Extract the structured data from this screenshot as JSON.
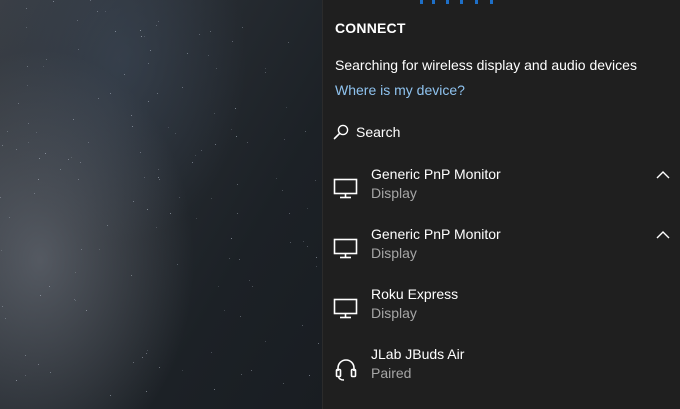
{
  "panel": {
    "title": "CONNECT",
    "status": "Searching for wireless display and audio devices",
    "help_link": "Where is my device?",
    "search_label": "Search",
    "accent_color": "#1e6fc7",
    "link_color": "#8fc3ef"
  },
  "devices": [
    {
      "name": "Generic PnP Monitor",
      "type": "Display",
      "icon": "monitor-icon",
      "expand_icon": "chevron-up-icon"
    },
    {
      "name": "Generic PnP Monitor",
      "type": "Display",
      "icon": "monitor-icon",
      "expand_icon": "chevron-up-icon"
    },
    {
      "name": "Roku Express",
      "type": "Display",
      "icon": "monitor-icon"
    },
    {
      "name": "JLab JBuds Air",
      "type": "Paired",
      "icon": "headset-icon"
    }
  ]
}
